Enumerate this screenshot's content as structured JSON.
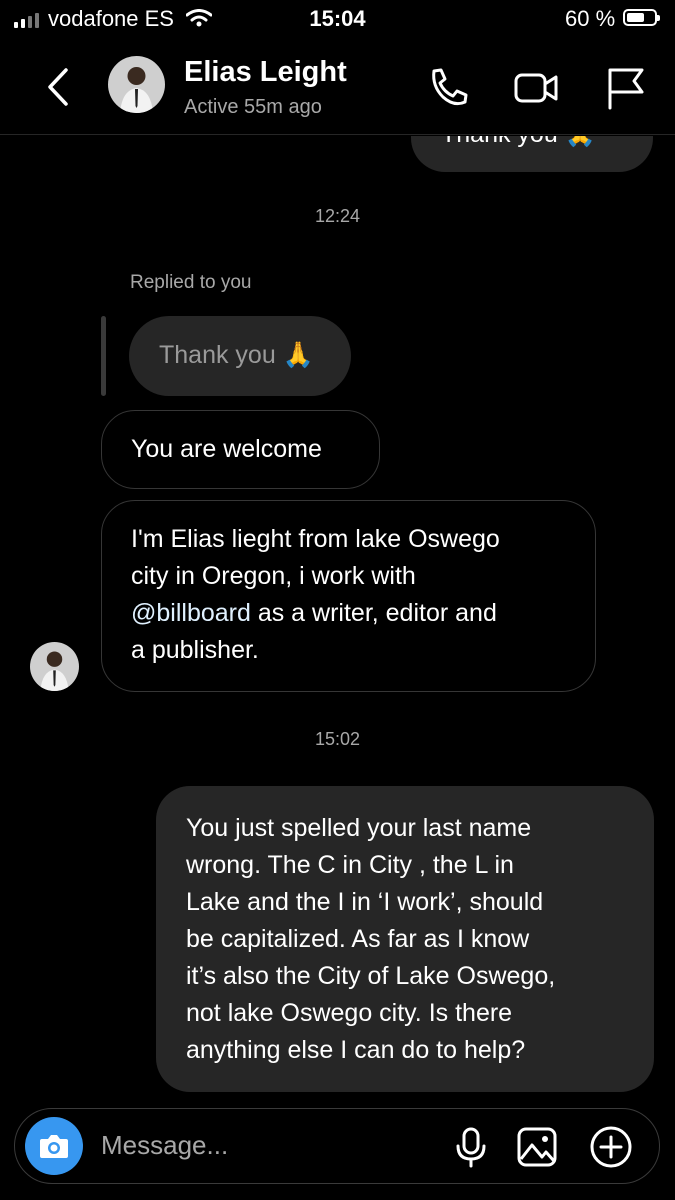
{
  "status_bar": {
    "carrier": "vodafone ES",
    "time": "15:04",
    "battery": "60 %"
  },
  "header": {
    "name": "Elias Leight",
    "status": "Active 55m ago"
  },
  "messages": {
    "partial_sent": "Thank you 🙏",
    "time_1": "12:24",
    "replied_label": "Replied to you",
    "reply_quote": "Thank you 🙏",
    "welcome": "You are welcome",
    "intro_line1": "I'm Elias lieght from lake Oswego",
    "intro_line2": "city in Oregon, i work with",
    "intro_mention": "@billboard",
    "intro_line3_rest": " as a writer, editor and",
    "intro_line4": "a publisher.",
    "time_2": "15:02",
    "reply_lines": [
      "You just spelled your last name",
      "wrong. The C in City , the L in",
      "Lake and the I in ‘I work’, should",
      "be capitalized. As far as I know",
      "it’s also the City of Lake Oswego,",
      "not lake Oswego city. Is there",
      "anything else I can do to help?"
    ]
  },
  "composer": {
    "placeholder": "Message..."
  },
  "colors": {
    "accent": "#3797f0",
    "bubble_sent": "#262626",
    "border_received": "#363636"
  }
}
